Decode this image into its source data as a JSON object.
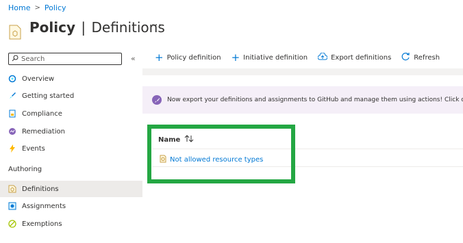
{
  "breadcrumb": {
    "home": "Home",
    "policy": "Policy"
  },
  "header": {
    "title_main": "Policy",
    "title_separator": "|",
    "title_sub": "Definitions",
    "more": "···"
  },
  "sidebar": {
    "search_placeholder": "Search",
    "collapse": "«",
    "items": [
      {
        "label": "Overview",
        "icon": "overview-icon"
      },
      {
        "label": "Getting started",
        "icon": "rocket-icon"
      },
      {
        "label": "Compliance",
        "icon": "compliance-icon"
      },
      {
        "label": "Remediation",
        "icon": "remediation-icon"
      },
      {
        "label": "Events",
        "icon": "lightning-icon"
      }
    ],
    "section_authoring": "Authoring",
    "authoring_items": [
      {
        "label": "Definitions",
        "icon": "definition-icon",
        "active": true
      },
      {
        "label": "Assignments",
        "icon": "assignment-icon"
      },
      {
        "label": "Exemptions",
        "icon": "exemption-icon"
      }
    ]
  },
  "toolbar": {
    "policy_definition": "Policy definition",
    "initiative_definition": "Initiative definition",
    "export_definitions": "Export definitions",
    "refresh": "Refresh"
  },
  "banner": {
    "text": "Now export your definitions and assignments to GitHub and manage them using actions! Click on 'Expo"
  },
  "table": {
    "column_name": "Name",
    "rows": [
      {
        "name": "Not allowed resource types"
      }
    ]
  },
  "colors": {
    "accent": "#0078d4",
    "highlight": "#24a743",
    "banner_bg": "#f5eff8"
  }
}
